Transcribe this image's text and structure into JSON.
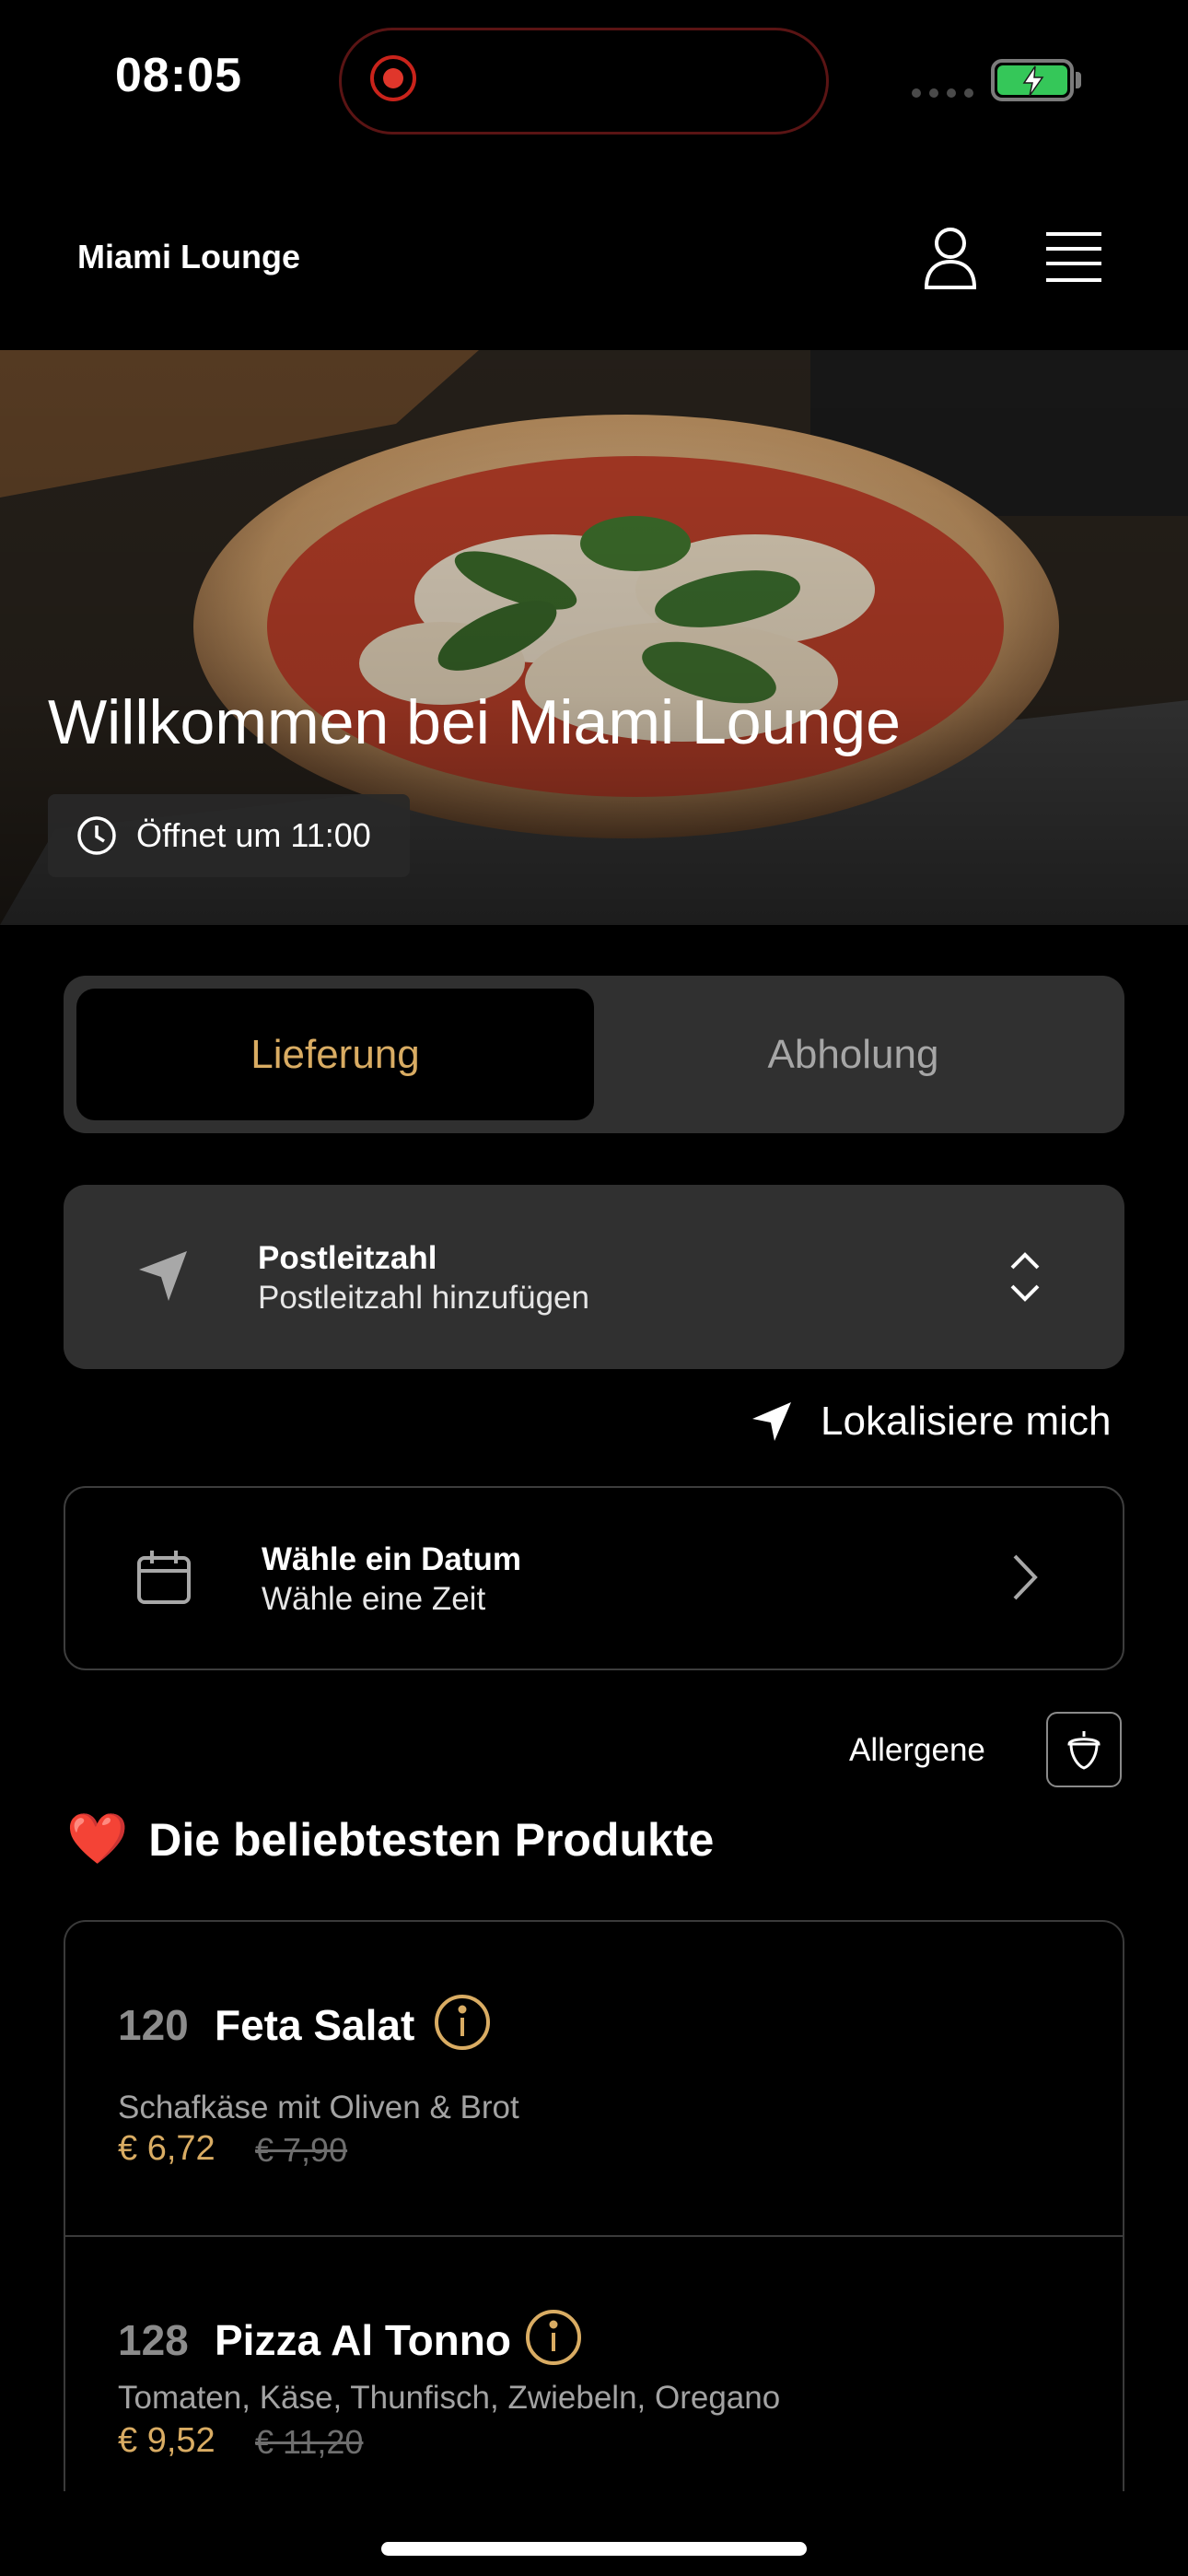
{
  "status_bar": {
    "time": "08:05"
  },
  "header": {
    "brand": "Miami Lounge"
  },
  "hero": {
    "title": "Willkommen bei Miami Lounge",
    "opening_text": "Öffnet um 11:00"
  },
  "order_mode": {
    "delivery": "Lieferung",
    "pickup": "Abholung",
    "selected": "delivery"
  },
  "postal": {
    "title": "Postleitzahl",
    "placeholder": "Postleitzahl hinzufügen"
  },
  "localize": {
    "label": "Lokalisiere mich"
  },
  "datetime": {
    "title": "Wähle ein Datum",
    "subtitle": "Wähle eine Zeit"
  },
  "allergens": {
    "label": "Allergene"
  },
  "popular": {
    "emoji": "❤️",
    "title": "Die beliebtesten Produkte"
  },
  "products": [
    {
      "number": "120",
      "name": "Feta Salat",
      "description": "Schafkäse mit Oliven & Brot",
      "price": "€ 6,72",
      "old_price": "€ 7,90"
    },
    {
      "number": "128",
      "name": "Pizza Al Tonno",
      "description": "Tomaten, Käse, Thunfisch, Zwiebeln, Oregano",
      "price": "€ 9,52",
      "old_price": "€ 11,20"
    }
  ],
  "colors": {
    "accent_gold": "#d9ac63",
    "background": "#000000",
    "card_bg": "#303030",
    "recording_red": "#e0362b",
    "battery_green": "#35c759"
  }
}
